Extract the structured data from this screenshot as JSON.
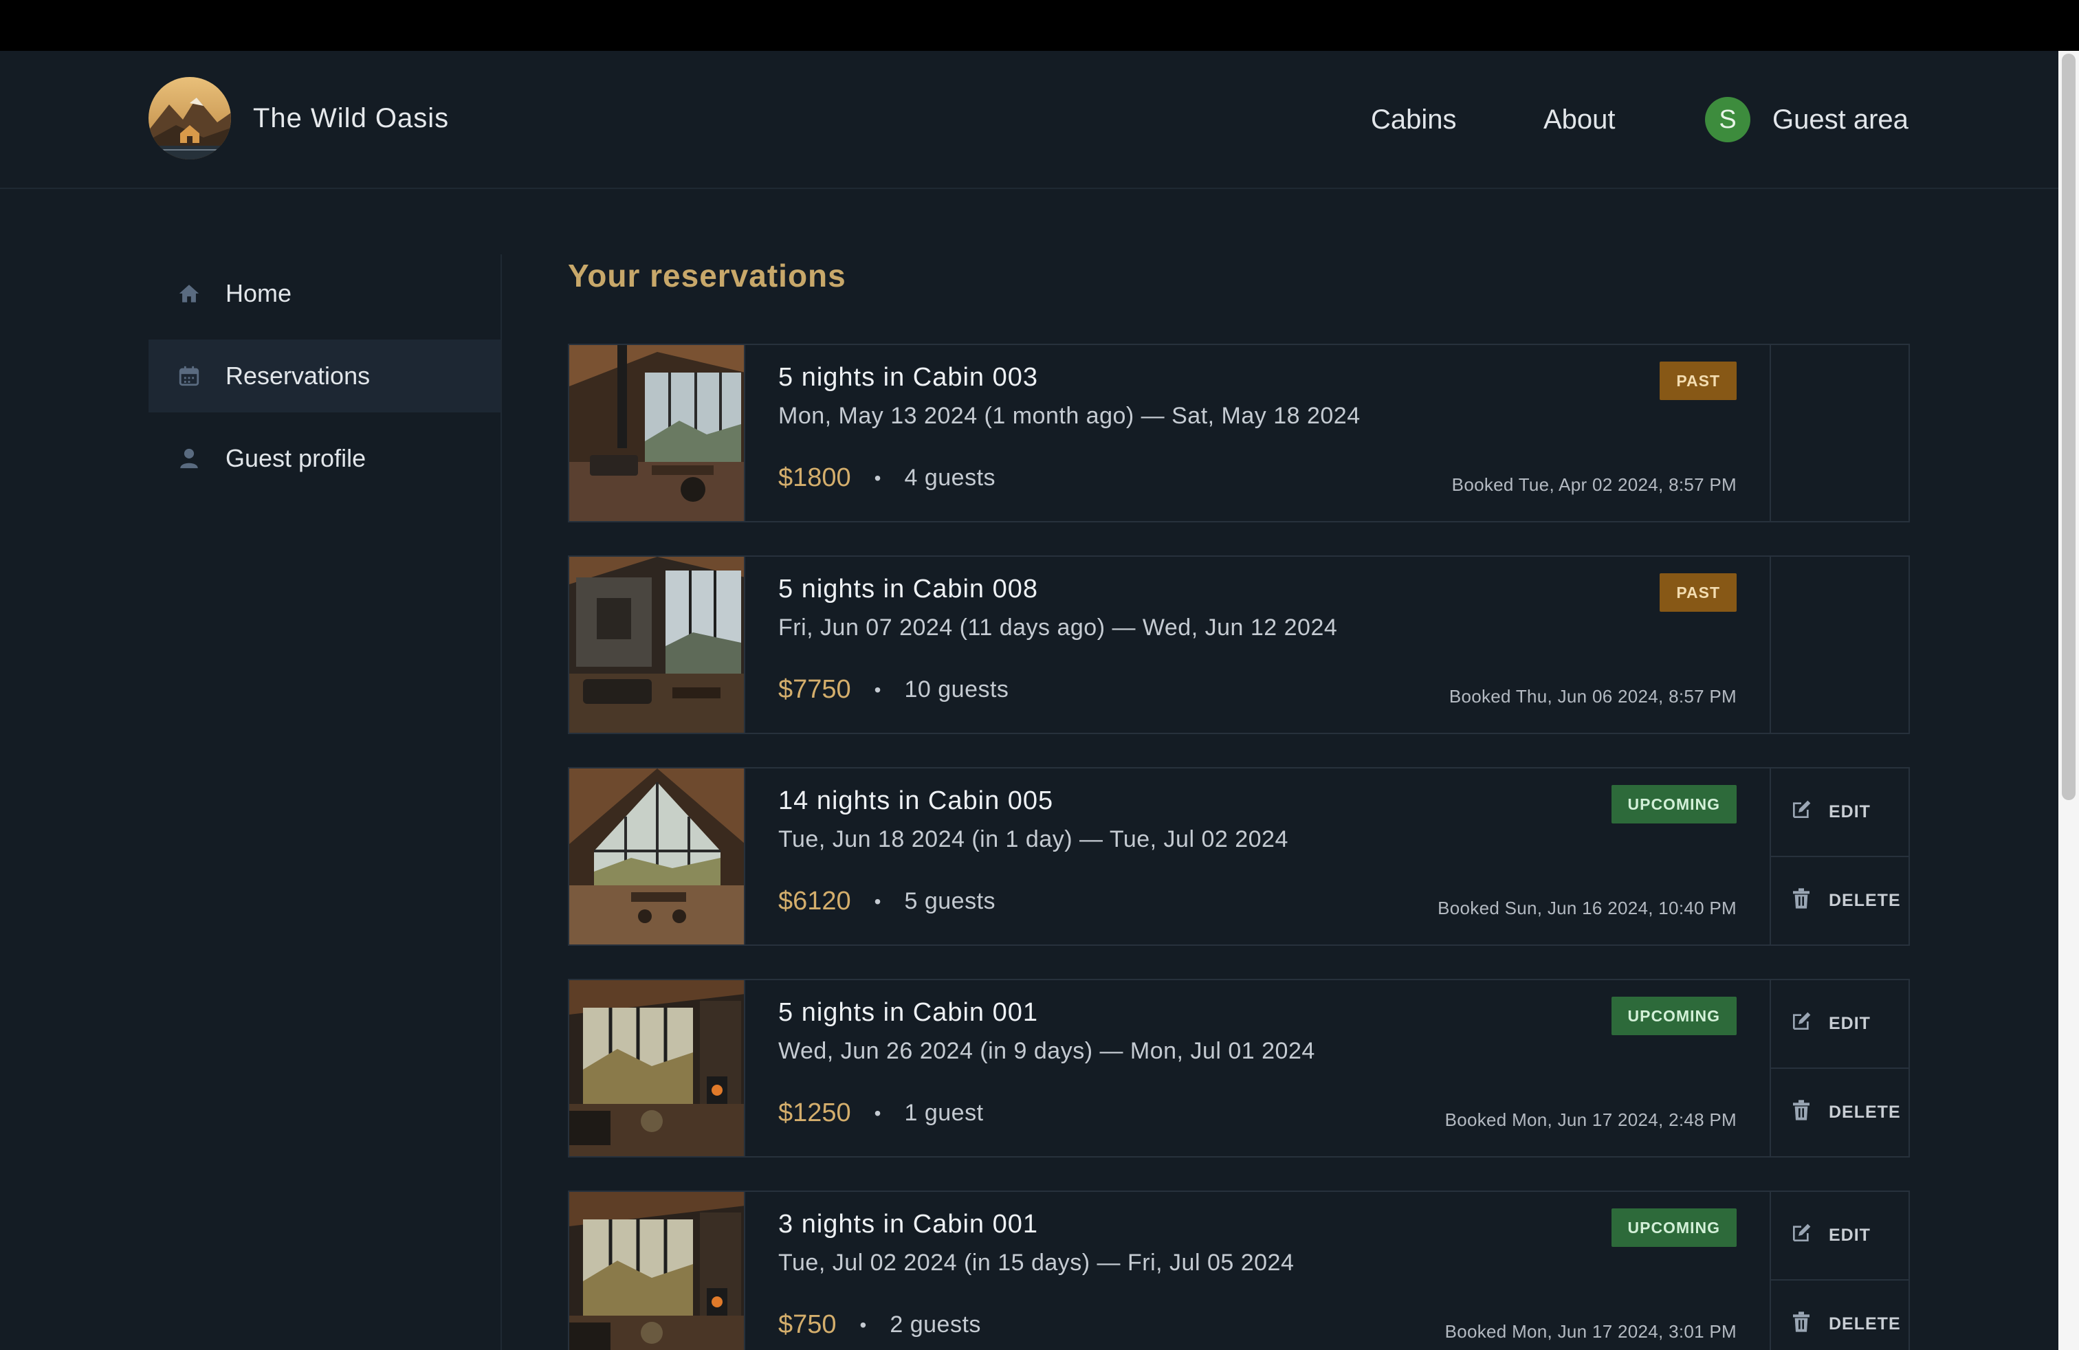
{
  "app": {
    "name": "The Wild Oasis"
  },
  "nav": {
    "cabins": "Cabins",
    "about": "About",
    "guest_area": "Guest area",
    "avatar_initial": "S"
  },
  "sidebar": {
    "items": [
      {
        "label": "Home",
        "icon": "home-icon"
      },
      {
        "label": "Reservations",
        "icon": "calendar-icon",
        "active": true
      },
      {
        "label": "Guest profile",
        "icon": "user-icon"
      }
    ]
  },
  "page": {
    "title": "Your reservations"
  },
  "actions": {
    "edit": "EDIT",
    "delete": "DELETE"
  },
  "reservations": [
    {
      "title": "5 nights in Cabin 003",
      "dates": "Mon, May 13 2024 (1 month ago) — Sat, May 18 2024",
      "price": "$1800",
      "guests": "4 guests",
      "booked": "Booked Tue, Apr 02 2024, 8:57 PM",
      "status": "PAST"
    },
    {
      "title": "5 nights in Cabin 008",
      "dates": "Fri, Jun 07 2024 (11 days ago) — Wed, Jun 12 2024",
      "price": "$7750",
      "guests": "10 guests",
      "booked": "Booked Thu, Jun 06 2024, 8:57 PM",
      "status": "PAST"
    },
    {
      "title": "14 nights in Cabin 005",
      "dates": "Tue, Jun 18 2024 (in 1 day) — Tue, Jul 02 2024",
      "price": "$6120",
      "guests": "5 guests",
      "booked": "Booked Sun, Jun 16 2024, 10:40 PM",
      "status": "UPCOMING"
    },
    {
      "title": "5 nights in Cabin 001",
      "dates": "Wed, Jun 26 2024 (in 9 days) — Mon, Jul 01 2024",
      "price": "$1250",
      "guests": "1 guest",
      "booked": "Booked Mon, Jun 17 2024, 2:48 PM",
      "status": "UPCOMING"
    },
    {
      "title": "3 nights in Cabin 001",
      "dates": "Tue, Jul 02 2024 (in 15 days) — Fri, Jul 05 2024",
      "price": "$750",
      "guests": "2 guests",
      "booked": "Booked Mon, Jun 17 2024, 3:01 PM",
      "status": "UPCOMING"
    }
  ],
  "colors": {
    "background": "#141c24",
    "accent": "#d4ae6c",
    "past": "#875816",
    "upcoming": "#2d6a3a",
    "avatar": "#3d8c3d"
  }
}
